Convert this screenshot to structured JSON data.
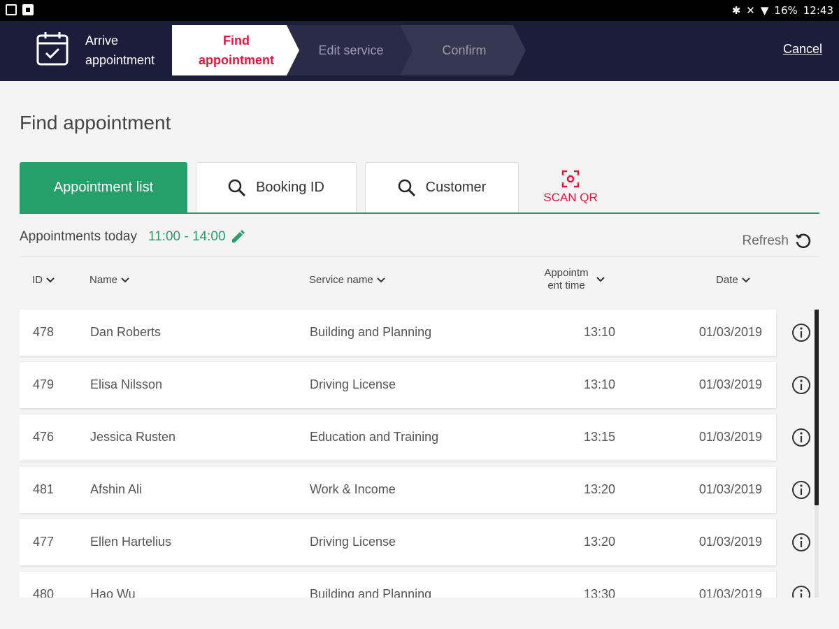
{
  "status_bar": {
    "battery": "16%",
    "time": "12:43"
  },
  "header": {
    "title": "Arrive appointment",
    "steps": [
      {
        "label": "Find appointment",
        "active": true
      },
      {
        "label": "Edit service",
        "active": false
      },
      {
        "label": "Confirm",
        "active": false
      }
    ],
    "cancel_label": "Cancel"
  },
  "page_title": "Find appointment",
  "tabs": {
    "appointment_list": "Appointment list",
    "booking_id": "Booking ID",
    "customer": "Customer",
    "scan_qr": "SCAN QR"
  },
  "appointments_today": {
    "label": "Appointments today",
    "time_range": "11:00 - 14:00",
    "refresh_label": "Refresh"
  },
  "table": {
    "columns": {
      "id": "ID",
      "name": "Name",
      "service": "Service name",
      "time": "Appointm ent time",
      "date": "Date"
    },
    "rows": [
      {
        "id": "478",
        "name": "Dan Roberts",
        "service": "Building and Planning",
        "time": "13:10",
        "date": "01/03/2019"
      },
      {
        "id": "479",
        "name": "Elisa Nilsson",
        "service": "Driving License",
        "time": "13:10",
        "date": "01/03/2019"
      },
      {
        "id": "476",
        "name": "Jessica Rusten",
        "service": "Education and Training",
        "time": "13:15",
        "date": "01/03/2019"
      },
      {
        "id": "481",
        "name": "Afshin Ali",
        "service": "Work & Income",
        "time": "13:20",
        "date": "01/03/2019"
      },
      {
        "id": "477",
        "name": "Ellen Hartelius",
        "service": "Driving License",
        "time": "13:20",
        "date": "01/03/2019"
      },
      {
        "id": "480",
        "name": "Hao Wu",
        "service": "Building and Planning",
        "time": "13:30",
        "date": "01/03/2019"
      }
    ]
  },
  "colors": {
    "header_bg": "#1c1d3a",
    "accent_green": "#26a06b",
    "accent_red": "#e0173e"
  }
}
